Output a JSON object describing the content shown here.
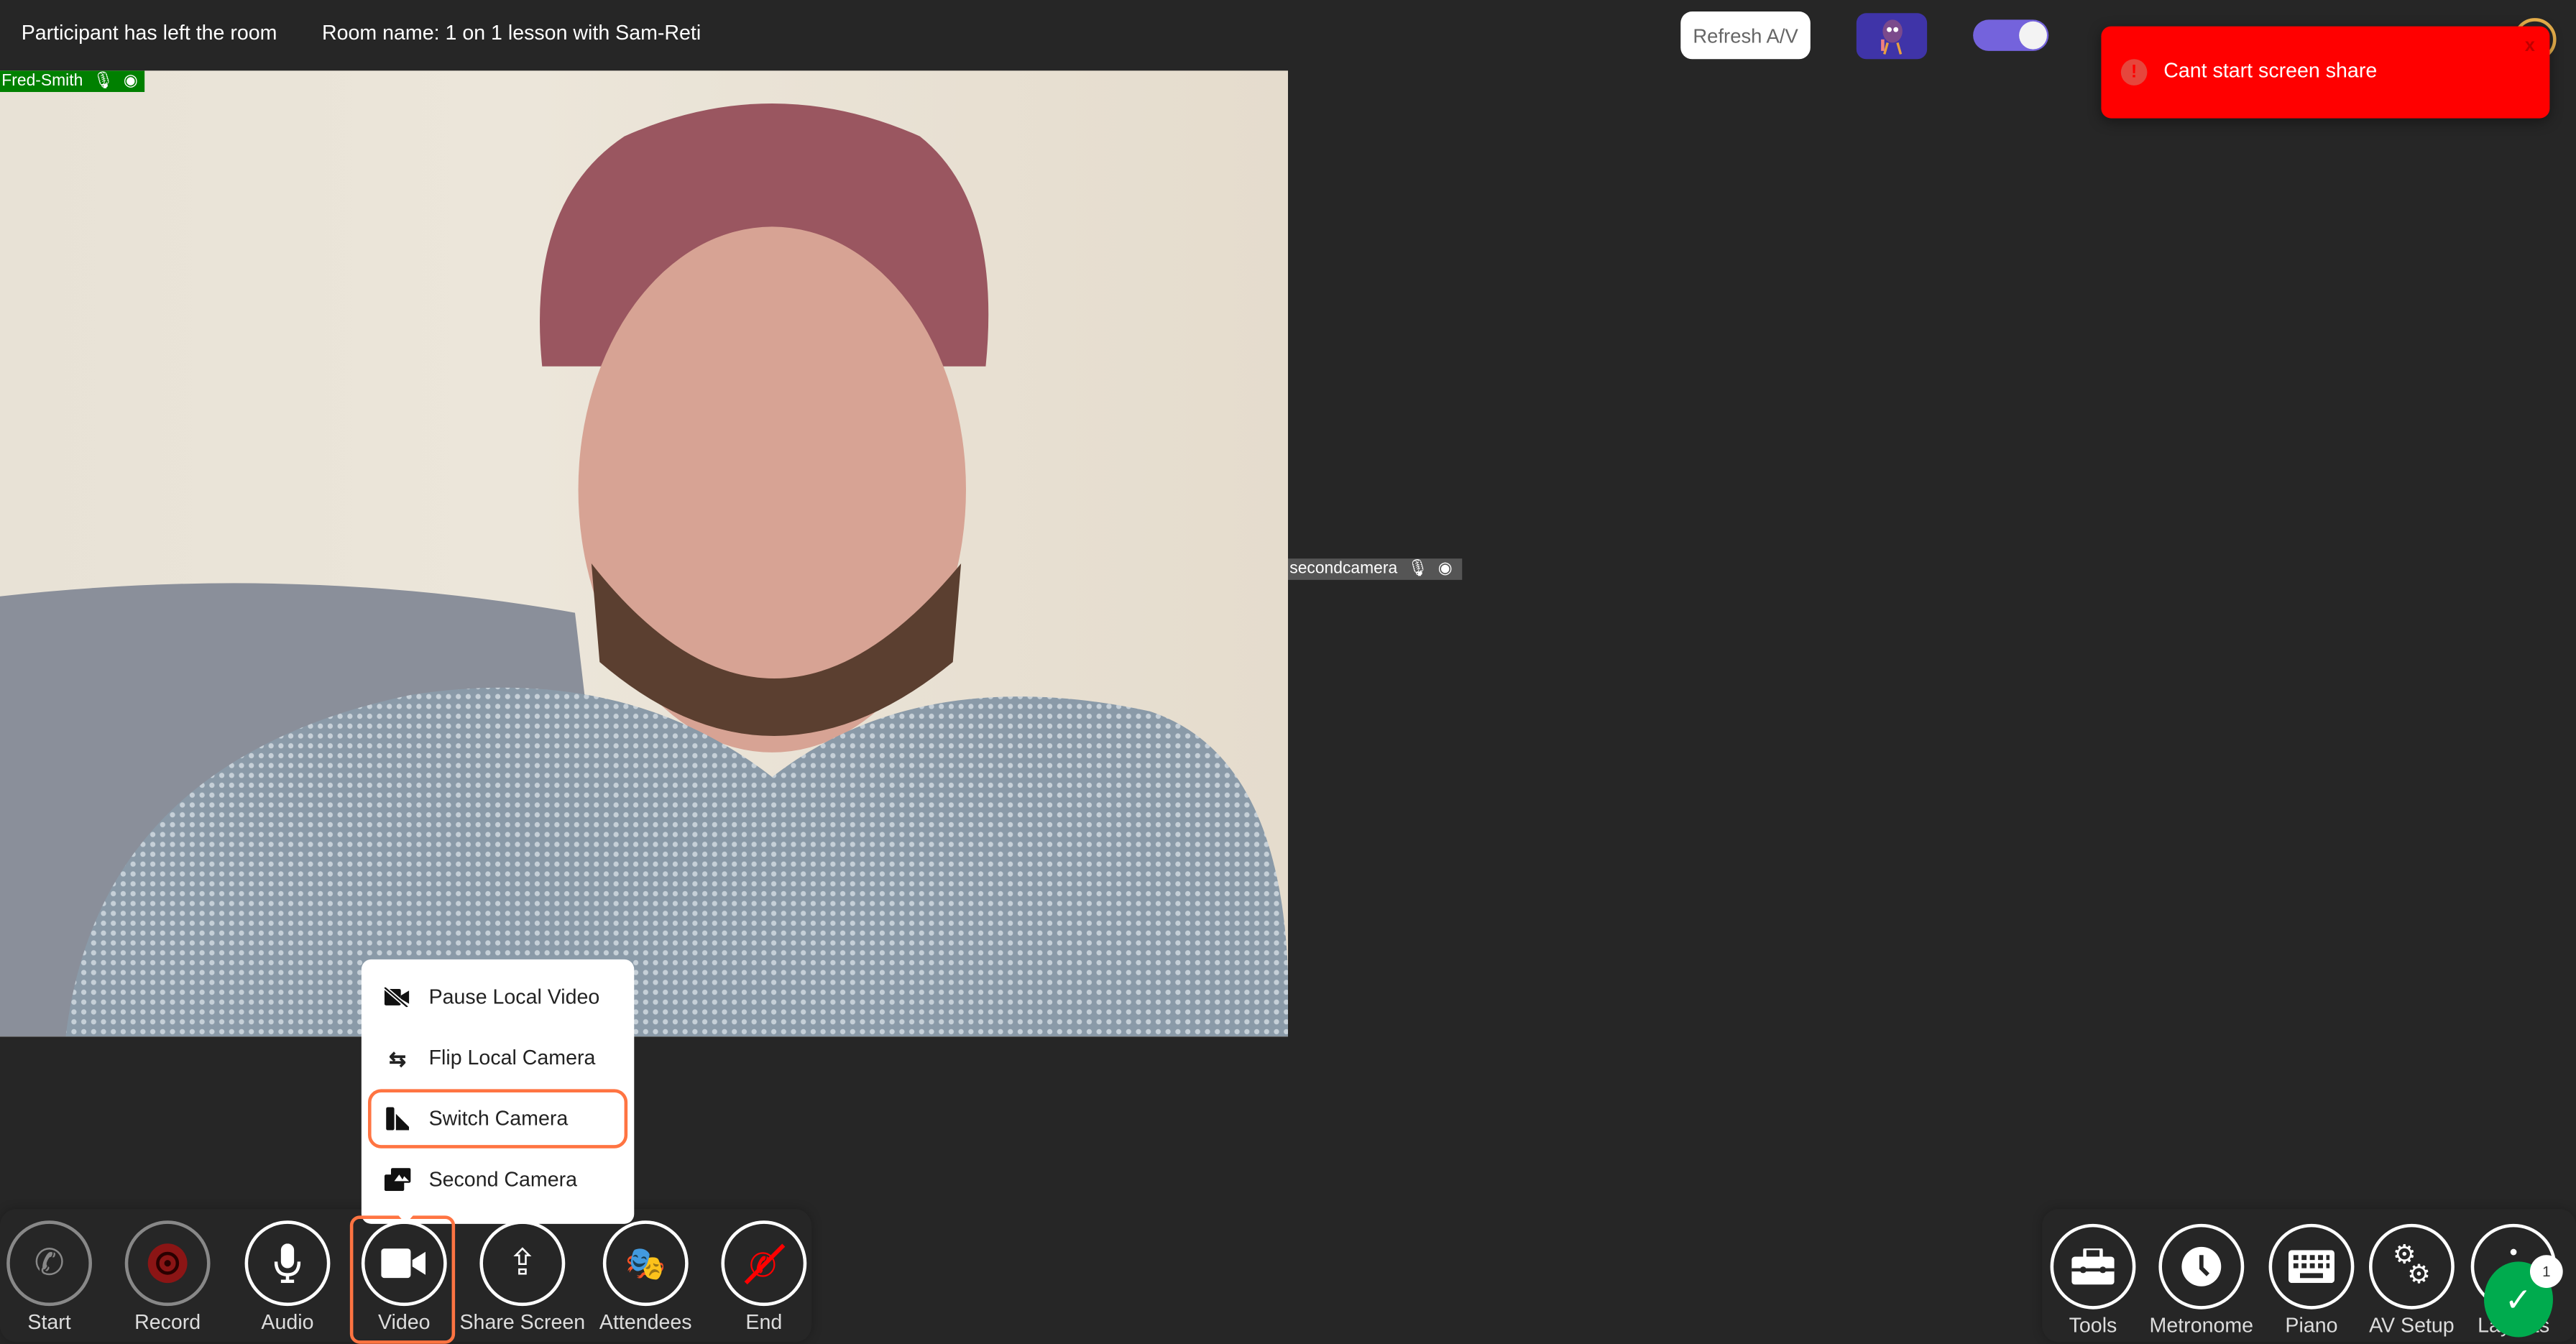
{
  "header": {
    "status": "Participant has left the room",
    "room_name": "Room name: 1 on 1 lesson with Sam-Reti",
    "refresh_label": "Refresh A/V",
    "toggle_on": true
  },
  "toast": {
    "message": "Cant start screen share",
    "close": "x",
    "color": "#ff0000"
  },
  "video": {
    "participant": "Fred-Smith",
    "second_participant": "secondcamera"
  },
  "video_menu": {
    "items": [
      {
        "label": "Pause Local Video",
        "icon": "video-off-icon"
      },
      {
        "label": "Flip Local Camera",
        "icon": "flip-icon"
      },
      {
        "label": "Switch Camera",
        "icon": "switch-camera-icon",
        "highlighted": true
      },
      {
        "label": "Second Camera",
        "icon": "second-camera-icon"
      }
    ]
  },
  "left_controls": [
    {
      "label": "Start",
      "icon": "phone-icon"
    },
    {
      "label": "Record",
      "icon": "record-icon"
    },
    {
      "label": "Audio",
      "icon": "microphone-icon"
    },
    {
      "label": "Video",
      "icon": "video-camera-icon",
      "active": true
    },
    {
      "label": "Share Screen",
      "icon": "share-screen-icon"
    },
    {
      "label": "Attendees",
      "icon": "theater-masks-icon"
    },
    {
      "label": "End",
      "icon": "end-call-icon"
    }
  ],
  "right_controls": [
    {
      "label": "Tools",
      "icon": "toolbox-icon"
    },
    {
      "label": "Metronome",
      "icon": "clock-icon"
    },
    {
      "label": "Piano",
      "icon": "keyboard-icon"
    },
    {
      "label": "AV Setup",
      "icon": "gears-icon"
    },
    {
      "label": "Layouts",
      "icon": "layouts-icon"
    }
  ],
  "notification": {
    "count": "1"
  },
  "colors": {
    "accent": "#ff7442",
    "toggle": "#7463dc",
    "tag_green": "#008000"
  }
}
